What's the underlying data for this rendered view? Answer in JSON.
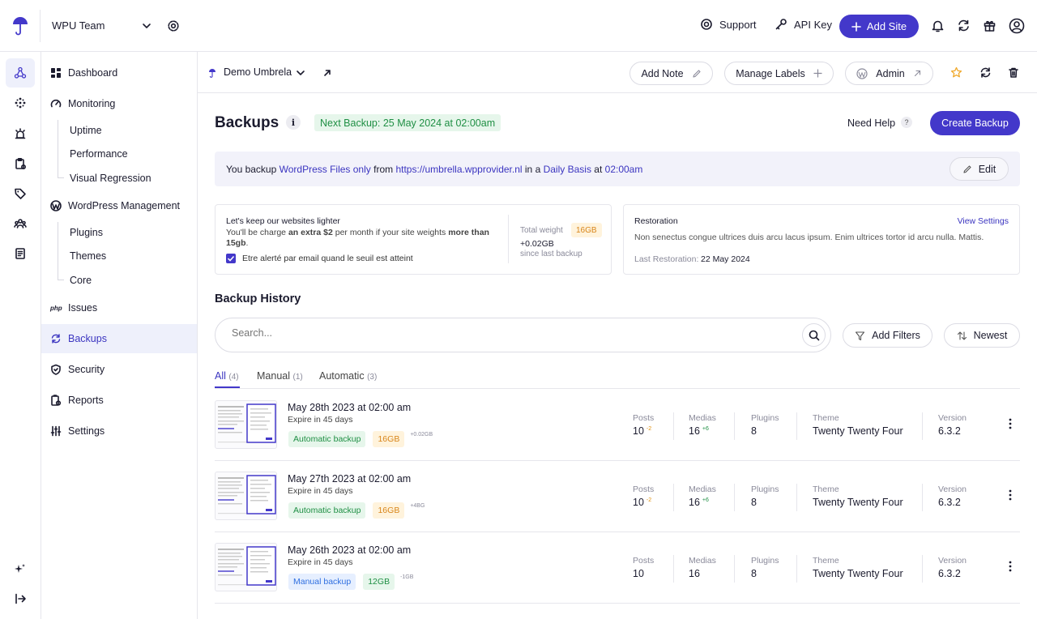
{
  "topbar": {
    "team_name": "WPU Team",
    "support_label": "Support",
    "api_key_label": "API Key",
    "add_site_label": "Add Site"
  },
  "sidebar": {
    "dashboard": "Dashboard",
    "monitoring": "Monitoring",
    "monitoring_items": [
      "Uptime",
      "Performance",
      "Visual Regression"
    ],
    "wordpress_management": "WordPress Management",
    "wordpress_items": [
      "Plugins",
      "Themes",
      "Core"
    ],
    "issues_badge": "php",
    "issues": "Issues",
    "backups": "Backups",
    "security": "Security",
    "reports": "Reports",
    "settings": "Settings"
  },
  "sitebar": {
    "site_name": "Demo Umbrela",
    "add_note": "Add Note",
    "manage_labels": "Manage Labels",
    "admin": "Admin"
  },
  "header": {
    "title": "Backups",
    "next_backup": "Next Backup: 25 May 2024 at 02:00am",
    "need_help": "Need Help",
    "help_badge": "?",
    "create_backup": "Create Backup"
  },
  "summary": {
    "prefix": "You backup",
    "what": "WordPress Files only",
    "from": "from",
    "url": "https://umbrella.wpprovider.nl",
    "in_a": "in a",
    "frequency": "Daily Basis",
    "at": "at",
    "time": "02:00am",
    "edit": "Edit"
  },
  "weight_card": {
    "title": "Let's keep our websites lighter",
    "text_1": "You'll be charge ",
    "text_bold_1": "an extra $2",
    "text_2": " per month if your site weights ",
    "text_bold_2": "more than 15gb",
    "text_3": ".",
    "checkbox_label": "Etre alerté par email quand le seuil est atteint",
    "checkbox_checked": true,
    "total_weight_label": "Total weight",
    "total_weight_value": "16GB",
    "delta": "+0.02GB",
    "since": "since last backup"
  },
  "restoration_card": {
    "title": "Restoration",
    "view_settings": "View Settings",
    "text": "Non senectus congue ultrices duis arcu lacus ipsum. Enim ultrices tortor id arcu nulla. Mattis.",
    "last_label": "Last Restoration:",
    "last_value": "22 May 2024"
  },
  "history": {
    "title": "Backup History",
    "search_placeholder": "Search...",
    "add_filters": "Add Filters",
    "sort": "Newest",
    "tabs": [
      {
        "label": "All",
        "count": "(4)"
      },
      {
        "label": "Manual",
        "count": "(1)"
      },
      {
        "label": "Automatic",
        "count": "(3)"
      }
    ],
    "stat_labels": {
      "posts": "Posts",
      "medias": "Medias",
      "plugins": "Plugins",
      "theme": "Theme",
      "version": "Version"
    },
    "rows": [
      {
        "date": "May 28th 2023 at 02:00 am",
        "expire": "Expire in 45 days",
        "type": "Automatic backup",
        "size": "16GB",
        "delta": "+0.02GB",
        "posts": "10",
        "posts_delta": "-2",
        "medias": "16",
        "medias_delta": "+6",
        "plugins": "8",
        "theme": "Twenty Twenty Four",
        "version": "6.3.2"
      },
      {
        "date": "May 27th 2023 at 02:00 am",
        "expire": "Expire in 45 days",
        "type": "Automatic backup",
        "size": "16GB",
        "delta": "+4BG",
        "posts": "10",
        "posts_delta": "-2",
        "medias": "16",
        "medias_delta": "+6",
        "plugins": "8",
        "theme": "Twenty Twenty Four",
        "version": "6.3.2"
      },
      {
        "date": "May 26th 2023 at 02:00 am",
        "expire": "Expire in 45 days",
        "type": "Manual backup",
        "size": "12GB",
        "delta": "-1GB",
        "posts": "10",
        "posts_delta": "",
        "medias": "16",
        "medias_delta": "",
        "plugins": "8",
        "theme": "Twenty Twenty Four",
        "version": "6.3.2"
      }
    ]
  },
  "colors": {
    "accent": "#4338ca",
    "accent_bg": "#eef0fb",
    "green": "#1f8f44",
    "orange": "#d8851a",
    "blue": "#2f6fe0"
  }
}
